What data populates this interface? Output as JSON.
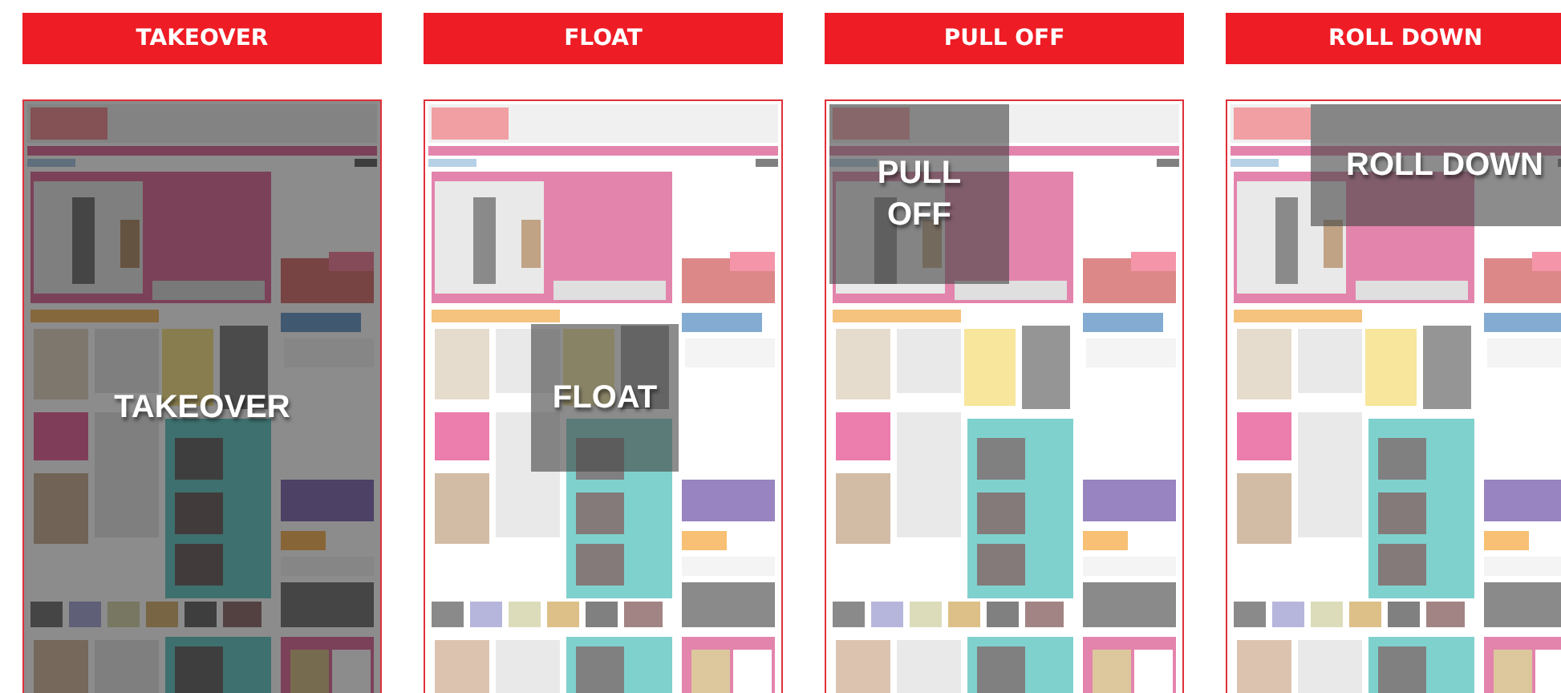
{
  "formats": [
    {
      "title": "TAKEOVER",
      "overlay": {
        "kind": "takeover",
        "label": "TAKEOVER"
      }
    },
    {
      "title": "FLOAT",
      "overlay": {
        "kind": "float",
        "label": "FLOAT"
      }
    },
    {
      "title": "PULL OFF",
      "overlay": {
        "kind": "pull_off",
        "label": "PULL OFF"
      }
    },
    {
      "title": "ROLL DOWN",
      "overlay": {
        "kind": "roll_down",
        "label": "ROLL DOWN"
      }
    }
  ]
}
